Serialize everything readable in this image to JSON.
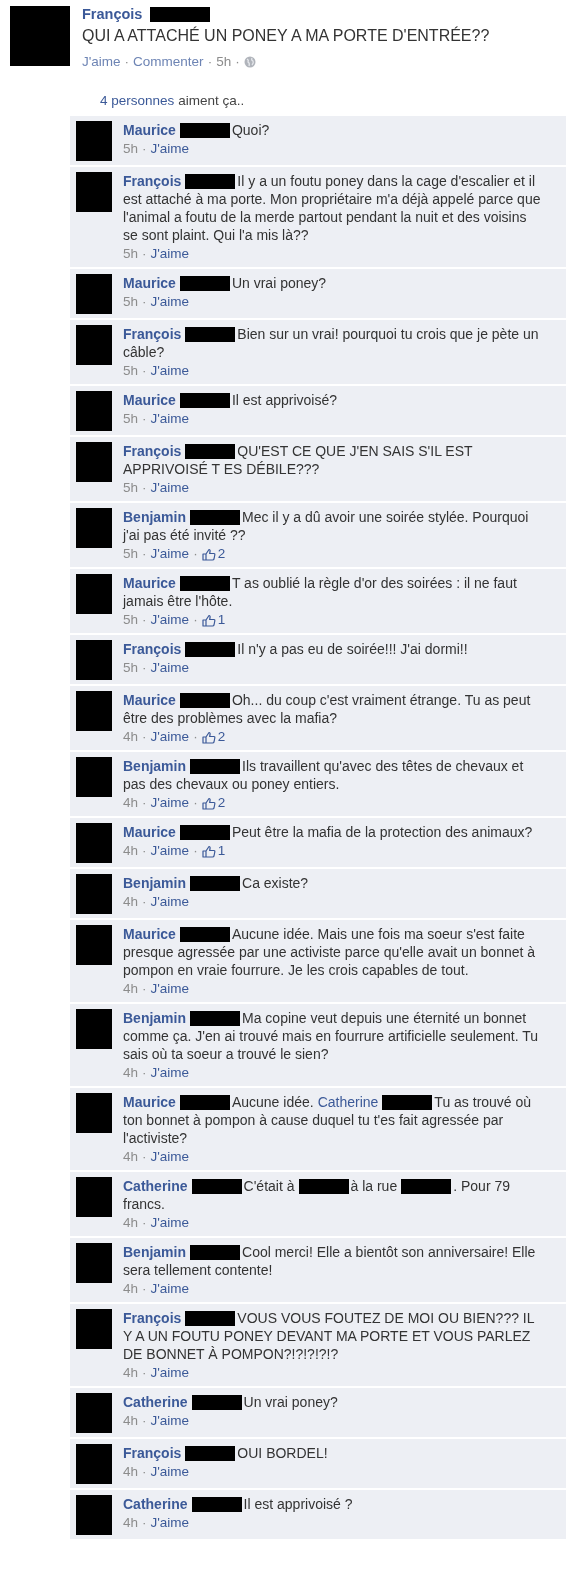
{
  "post": {
    "author": "François",
    "text": "QUI A ATTACHÉ UN PONEY A MA PORTE D'ENTRÉE??",
    "meta": [
      {
        "kind": "link",
        "text": "J'aime"
      },
      {
        "kind": "sep",
        "text": "·"
      },
      {
        "kind": "link",
        "text": "Commenter"
      },
      {
        "kind": "sep",
        "text": "·"
      },
      {
        "kind": "time",
        "text": "5h"
      },
      {
        "kind": "sep",
        "text": "·"
      },
      {
        "kind": "globe"
      }
    ]
  },
  "likes_summary": {
    "link": "4 personnes",
    "text": "aiment ça.."
  },
  "comments": [
    {
      "author": "Maurice",
      "parts": [
        {
          "kind": "redacted"
        },
        {
          "kind": "text",
          "text": "Quoi?"
        }
      ],
      "meta": [
        {
          "kind": "time",
          "text": "5h"
        },
        {
          "kind": "sep",
          "text": "·"
        },
        {
          "kind": "link",
          "text": "J'aime"
        }
      ]
    },
    {
      "author": "François",
      "parts": [
        {
          "kind": "redacted"
        },
        {
          "kind": "text",
          "text": "Il y a un foutu poney dans la cage d'escalier et il est attaché à ma  porte. Mon propriétaire m'a déjà appelé parce que l'animal a foutu de la merde partout pendant la nuit et des voisins se sont plaint. Qui l'a mis là??"
        }
      ],
      "meta": [
        {
          "kind": "time",
          "text": "5h"
        },
        {
          "kind": "sep",
          "text": "·"
        },
        {
          "kind": "link",
          "text": "J'aime"
        }
      ]
    },
    {
      "author": "Maurice",
      "parts": [
        {
          "kind": "redacted"
        },
        {
          "kind": "text",
          "text": "Un vrai poney?"
        }
      ],
      "meta": [
        {
          "kind": "time",
          "text": "5h"
        },
        {
          "kind": "sep",
          "text": "·"
        },
        {
          "kind": "link",
          "text": "J'aime"
        }
      ]
    },
    {
      "author": "François",
      "parts": [
        {
          "kind": "redacted"
        },
        {
          "kind": "text",
          "text": "Bien sur un vrai! pourquoi tu crois que je pète un câble?"
        }
      ],
      "meta": [
        {
          "kind": "time",
          "text": "5h"
        },
        {
          "kind": "sep",
          "text": "·"
        },
        {
          "kind": "link",
          "text": "J'aime"
        }
      ]
    },
    {
      "author": "Maurice",
      "parts": [
        {
          "kind": "redacted"
        },
        {
          "kind": "text",
          "text": "Il est apprivoisé?"
        }
      ],
      "meta": [
        {
          "kind": "time",
          "text": "5h"
        },
        {
          "kind": "sep",
          "text": "·"
        },
        {
          "kind": "link",
          "text": "J'aime"
        }
      ]
    },
    {
      "author": "François",
      "parts": [
        {
          "kind": "redacted"
        },
        {
          "kind": "text",
          "text": "QU'EST CE QUE J'EN SAIS S'IL EST APPRIVOISÉ T ES DÉBILE???"
        }
      ],
      "meta": [
        {
          "kind": "time",
          "text": "5h"
        },
        {
          "kind": "sep",
          "text": "·"
        },
        {
          "kind": "link",
          "text": "J'aime"
        }
      ]
    },
    {
      "author": "Benjamin",
      "parts": [
        {
          "kind": "redacted"
        },
        {
          "kind": "text",
          "text": "Mec il y a dû avoir une soirée stylée. Pourquoi j'ai pas été invité ??"
        }
      ],
      "meta": [
        {
          "kind": "time",
          "text": "5h"
        },
        {
          "kind": "sep",
          "text": "·"
        },
        {
          "kind": "link",
          "text": "J'aime"
        },
        {
          "kind": "sep",
          "text": "·"
        },
        {
          "kind": "likes",
          "text": "2"
        }
      ]
    },
    {
      "author": "Maurice",
      "parts": [
        {
          "kind": "redacted"
        },
        {
          "kind": "text",
          "text": "T as oublié la règle d'or des soirées : il ne faut jamais être l'hôte."
        }
      ],
      "meta": [
        {
          "kind": "time",
          "text": "5h"
        },
        {
          "kind": "sep",
          "text": "·"
        },
        {
          "kind": "link",
          "text": "J'aime"
        },
        {
          "kind": "sep",
          "text": "·"
        },
        {
          "kind": "likes",
          "text": "1"
        }
      ]
    },
    {
      "author": "François",
      "parts": [
        {
          "kind": "redacted"
        },
        {
          "kind": "text",
          "text": "Il n'y a pas eu de soirée!!! J'ai dormi!!"
        }
      ],
      "meta": [
        {
          "kind": "time",
          "text": "5h"
        },
        {
          "kind": "sep",
          "text": "·"
        },
        {
          "kind": "link",
          "text": "J'aime"
        }
      ]
    },
    {
      "author": "Maurice",
      "parts": [
        {
          "kind": "redacted"
        },
        {
          "kind": "text",
          "text": "Oh... du coup c'est vraiment étrange. Tu as peut être des problèmes avec la mafia?"
        }
      ],
      "meta": [
        {
          "kind": "time",
          "text": "4h"
        },
        {
          "kind": "sep",
          "text": "·"
        },
        {
          "kind": "link",
          "text": "J'aime"
        },
        {
          "kind": "sep",
          "text": "·"
        },
        {
          "kind": "likes",
          "text": "2"
        }
      ]
    },
    {
      "author": "Benjamin",
      "parts": [
        {
          "kind": "redacted"
        },
        {
          "kind": "text",
          "text": "Ils travaillent qu'avec des têtes de chevaux et pas des chevaux ou poney entiers."
        }
      ],
      "meta": [
        {
          "kind": "time",
          "text": "4h"
        },
        {
          "kind": "sep",
          "text": "·"
        },
        {
          "kind": "link",
          "text": "J'aime"
        },
        {
          "kind": "sep",
          "text": "·"
        },
        {
          "kind": "likes",
          "text": "2"
        }
      ]
    },
    {
      "author": "Maurice",
      "parts": [
        {
          "kind": "redacted"
        },
        {
          "kind": "text",
          "text": "Peut être la mafia de la protection des animaux?"
        }
      ],
      "meta": [
        {
          "kind": "time",
          "text": "4h"
        },
        {
          "kind": "sep",
          "text": "·"
        },
        {
          "kind": "link",
          "text": "J'aime"
        },
        {
          "kind": "sep",
          "text": "·"
        },
        {
          "kind": "likes",
          "text": "1"
        }
      ]
    },
    {
      "author": "Benjamin",
      "parts": [
        {
          "kind": "redacted"
        },
        {
          "kind": "text",
          "text": "Ca existe?"
        }
      ],
      "meta": [
        {
          "kind": "time",
          "text": "4h"
        },
        {
          "kind": "sep",
          "text": "·"
        },
        {
          "kind": "link",
          "text": "J'aime"
        }
      ]
    },
    {
      "author": "Maurice",
      "parts": [
        {
          "kind": "redacted"
        },
        {
          "kind": "text",
          "text": "Aucune idée. Mais une fois ma soeur s'est faite presque agressée par une activiste parce qu'elle avait un bonnet à pompon en vraie fourrure. Je les crois capables de tout."
        }
      ],
      "meta": [
        {
          "kind": "time",
          "text": "4h"
        },
        {
          "kind": "sep",
          "text": "·"
        },
        {
          "kind": "link",
          "text": "J'aime"
        }
      ]
    },
    {
      "author": "Benjamin",
      "parts": [
        {
          "kind": "redacted"
        },
        {
          "kind": "text",
          "text": "Ma copine veut depuis une éternité un bonnet comme ça. J'en ai trouvé mais en fourrure artificielle seulement. Tu sais où ta soeur a trouvé le sien?"
        }
      ],
      "meta": [
        {
          "kind": "time",
          "text": "4h"
        },
        {
          "kind": "sep",
          "text": "·"
        },
        {
          "kind": "link",
          "text": "J'aime"
        }
      ]
    },
    {
      "author": "Maurice",
      "parts": [
        {
          "kind": "redacted"
        },
        {
          "kind": "text",
          "text": "Aucune idée."
        },
        {
          "kind": "mention",
          "text": "Catherine"
        },
        {
          "kind": "redacted"
        },
        {
          "kind": "text",
          "text": "Tu as trouvé où ton bonnet à pompon à cause duquel tu t'es fait agressée par l'activiste?"
        }
      ],
      "meta": [
        {
          "kind": "time",
          "text": "4h"
        },
        {
          "kind": "sep",
          "text": "·"
        },
        {
          "kind": "link",
          "text": "J'aime"
        }
      ]
    },
    {
      "author": "Catherine",
      "parts": [
        {
          "kind": "redacted"
        },
        {
          "kind": "text",
          "text": "C'était à"
        },
        {
          "kind": "redacted"
        },
        {
          "kind": "text",
          "text": "à la rue"
        },
        {
          "kind": "redacted"
        },
        {
          "kind": "text",
          "text": ". Pour 79 francs."
        }
      ],
      "meta": [
        {
          "kind": "time",
          "text": "4h"
        },
        {
          "kind": "sep",
          "text": "·"
        },
        {
          "kind": "link",
          "text": "J'aime"
        }
      ]
    },
    {
      "author": "Benjamin",
      "parts": [
        {
          "kind": "redacted"
        },
        {
          "kind": "text",
          "text": "Cool merci! Elle a bientôt son anniversaire! Elle sera tellement contente!"
        }
      ],
      "meta": [
        {
          "kind": "time",
          "text": "4h"
        },
        {
          "kind": "sep",
          "text": "·"
        },
        {
          "kind": "link",
          "text": "J'aime"
        }
      ]
    },
    {
      "author": "François",
      "parts": [
        {
          "kind": "redacted"
        },
        {
          "kind": "text",
          "text": "VOUS VOUS FOUTEZ DE MOI OU BIEN??? IL Y A UN FOUTU PONEY DEVANT MA PORTE ET VOUS PARLEZ DE BONNET À POMPON?!?!?!?!?"
        }
      ],
      "meta": [
        {
          "kind": "time",
          "text": "4h"
        },
        {
          "kind": "sep",
          "text": "·"
        },
        {
          "kind": "link",
          "text": "J'aime"
        }
      ]
    },
    {
      "author": "Catherine",
      "parts": [
        {
          "kind": "redacted"
        },
        {
          "kind": "text",
          "text": "Un vrai poney?"
        }
      ],
      "meta": [
        {
          "kind": "time",
          "text": "4h"
        },
        {
          "kind": "sep",
          "text": "·"
        },
        {
          "kind": "link",
          "text": "J'aime"
        }
      ]
    },
    {
      "author": "François",
      "parts": [
        {
          "kind": "redacted"
        },
        {
          "kind": "text",
          "text": "OUI BORDEL!"
        }
      ],
      "meta": [
        {
          "kind": "time",
          "text": "4h"
        },
        {
          "kind": "sep",
          "text": "·"
        },
        {
          "kind": "link",
          "text": "J'aime"
        }
      ]
    },
    {
      "author": "Catherine",
      "parts": [
        {
          "kind": "redacted"
        },
        {
          "kind": "text",
          "text": "Il est apprivoisé ?"
        }
      ],
      "meta": [
        {
          "kind": "time",
          "text": "4h"
        },
        {
          "kind": "sep",
          "text": "·"
        },
        {
          "kind": "link",
          "text": "J'aime"
        }
      ]
    }
  ]
}
